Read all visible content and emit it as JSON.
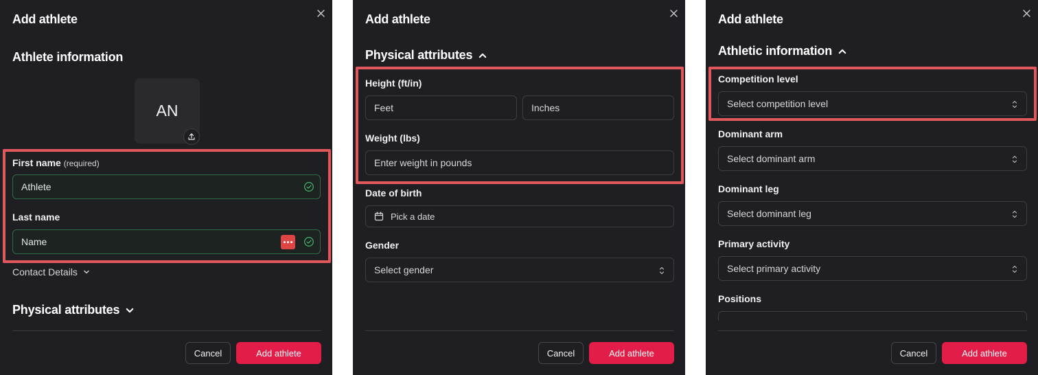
{
  "colors": {
    "panel_bg": "#1f1f23",
    "accent": "#e11d48",
    "highlight": "#e0575c",
    "valid_border": "#2f6b45",
    "valid_check": "#3fae6a"
  },
  "panel1": {
    "title": "Add athlete",
    "section": "Athlete information",
    "avatar_initials": "AN",
    "first_name": {
      "label": "First name",
      "required": "(required)",
      "value": "Athlete"
    },
    "last_name": {
      "label": "Last name",
      "value": "Name"
    },
    "contact_toggle": "Contact Details",
    "physical_section": "Physical attributes",
    "cancel_label": "Cancel",
    "submit_label": "Add athlete"
  },
  "panel2": {
    "title": "Add athlete",
    "section": "Physical attributes",
    "height_label": "Height (ft/in)",
    "feet_placeholder": "Feet",
    "inches_placeholder": "Inches",
    "weight_label": "Weight (lbs)",
    "weight_placeholder": "Enter weight in pounds",
    "dob_label": "Date of birth",
    "dob_placeholder": "Pick a date",
    "gender_label": "Gender",
    "gender_placeholder": "Select gender",
    "cancel_label": "Cancel",
    "submit_label": "Add athlete"
  },
  "panel3": {
    "title": "Add athlete",
    "section": "Athletic information",
    "competition_label": "Competition level",
    "competition_placeholder": "Select competition level",
    "arm_label": "Dominant arm",
    "arm_placeholder": "Select dominant arm",
    "leg_label": "Dominant leg",
    "leg_placeholder": "Select dominant leg",
    "activity_label": "Primary activity",
    "activity_placeholder": "Select primary activity",
    "positions_label": "Positions",
    "cancel_label": "Cancel",
    "submit_label": "Add athlete"
  }
}
